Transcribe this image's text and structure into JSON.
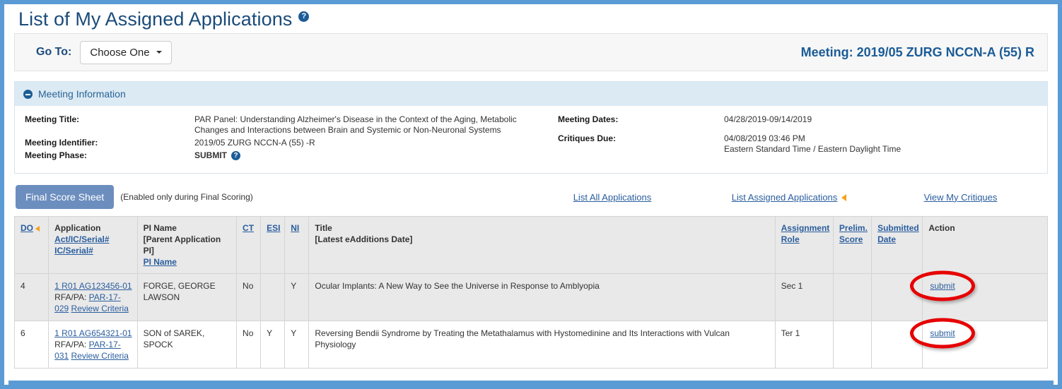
{
  "page": {
    "title": "List of My Assigned Applications",
    "help_icon_glyph": "?"
  },
  "goto_bar": {
    "label": "Go To:",
    "select_value": "Choose One",
    "meeting_header": "Meeting: 2019/05 ZURG NCCN-A (55) R"
  },
  "meeting_panel": {
    "header": "Meeting Information",
    "left": {
      "meeting_title_label": "Meeting Title:",
      "meeting_title_value": "PAR Panel: Understanding Alzheimer's Disease in the Context of the Aging, Metabolic Changes and Interactions between Brain and Systemic or Non-Neuronal Systems",
      "meeting_identifier_label": "Meeting Identifier:",
      "meeting_identifier_value": "2019/05 ZURG NCCN-A (55) -R",
      "meeting_phase_label": "Meeting Phase:",
      "meeting_phase_value": "SUBMIT"
    },
    "right": {
      "meeting_dates_label": "Meeting Dates:",
      "meeting_dates_value": "04/28/2019-09/14/2019",
      "critiques_due_label": "Critiques Due:",
      "critiques_due_value": "04/08/2019 03:46 PM",
      "critiques_due_tz": "Eastern Standard Time / Eastern Daylight Time"
    }
  },
  "toolbar": {
    "final_score_sheet_label": "Final Score Sheet",
    "note": "(Enabled only during Final Scoring)",
    "link_list_all": "List All Applications",
    "link_list_assigned": "List Assigned Applications",
    "link_view_critiques": "View My Critiques"
  },
  "table": {
    "headers": {
      "do": "DO",
      "application": "Application",
      "application_sub1": "Act/IC/Serial#",
      "application_sub2": "IC/Serial#",
      "pi_name": "PI Name",
      "pi_name_sub1": "[Parent Application PI]",
      "pi_name_sub2": "PI Name",
      "ct": "CT",
      "esi": "ESI",
      "ni": "NI",
      "title": "Title",
      "title_sub": "[Latest eAdditions Date]",
      "assignment_role": "Assignment Role",
      "prelim_score": "Prelim. Score",
      "submitted_date": "Submitted Date",
      "action": "Action"
    },
    "rows": [
      {
        "do": "4",
        "app_number": "1 R01 AG123456-01",
        "rfa_label": "RFA/PA:",
        "rfa_value": "PAR-17-029",
        "review_criteria": "Review Criteria",
        "pi_name": "FORGE, GEORGE LAWSON",
        "ct": "No",
        "esi": "",
        "ni": "Y",
        "title": "Ocular Implants: A New Way to See the Universe in Response to Amblyopia",
        "assignment_role": "Sec 1",
        "prelim_score": "",
        "submitted_date": "",
        "action": "submit"
      },
      {
        "do": "6",
        "app_number": "1 R01 AG654321-01",
        "rfa_label": "RFA/PA:",
        "rfa_value": "PAR-17-031",
        "review_criteria": "Review Criteria",
        "pi_name": "SON of SAREK, SPOCK",
        "ct": "No",
        "esi": "Y",
        "ni": "Y",
        "title": "Reversing Bendii Syndrome by Treating the Metathalamus with Hystomedinine and Its Interactions with Vulcan Physiology",
        "assignment_role": "Ter 1",
        "prelim_score": "",
        "submitted_date": "",
        "action": "submit"
      }
    ]
  },
  "colors": {
    "frame_blue": "#5b9bd5",
    "title_blue": "#1b4b79",
    "link_blue": "#2a5d9e",
    "panel_header_bg": "#dceaf4",
    "button_blue": "#6c8ebf",
    "annotation_red": "#e60000",
    "sort_arrow_orange": "#f5a11a"
  }
}
